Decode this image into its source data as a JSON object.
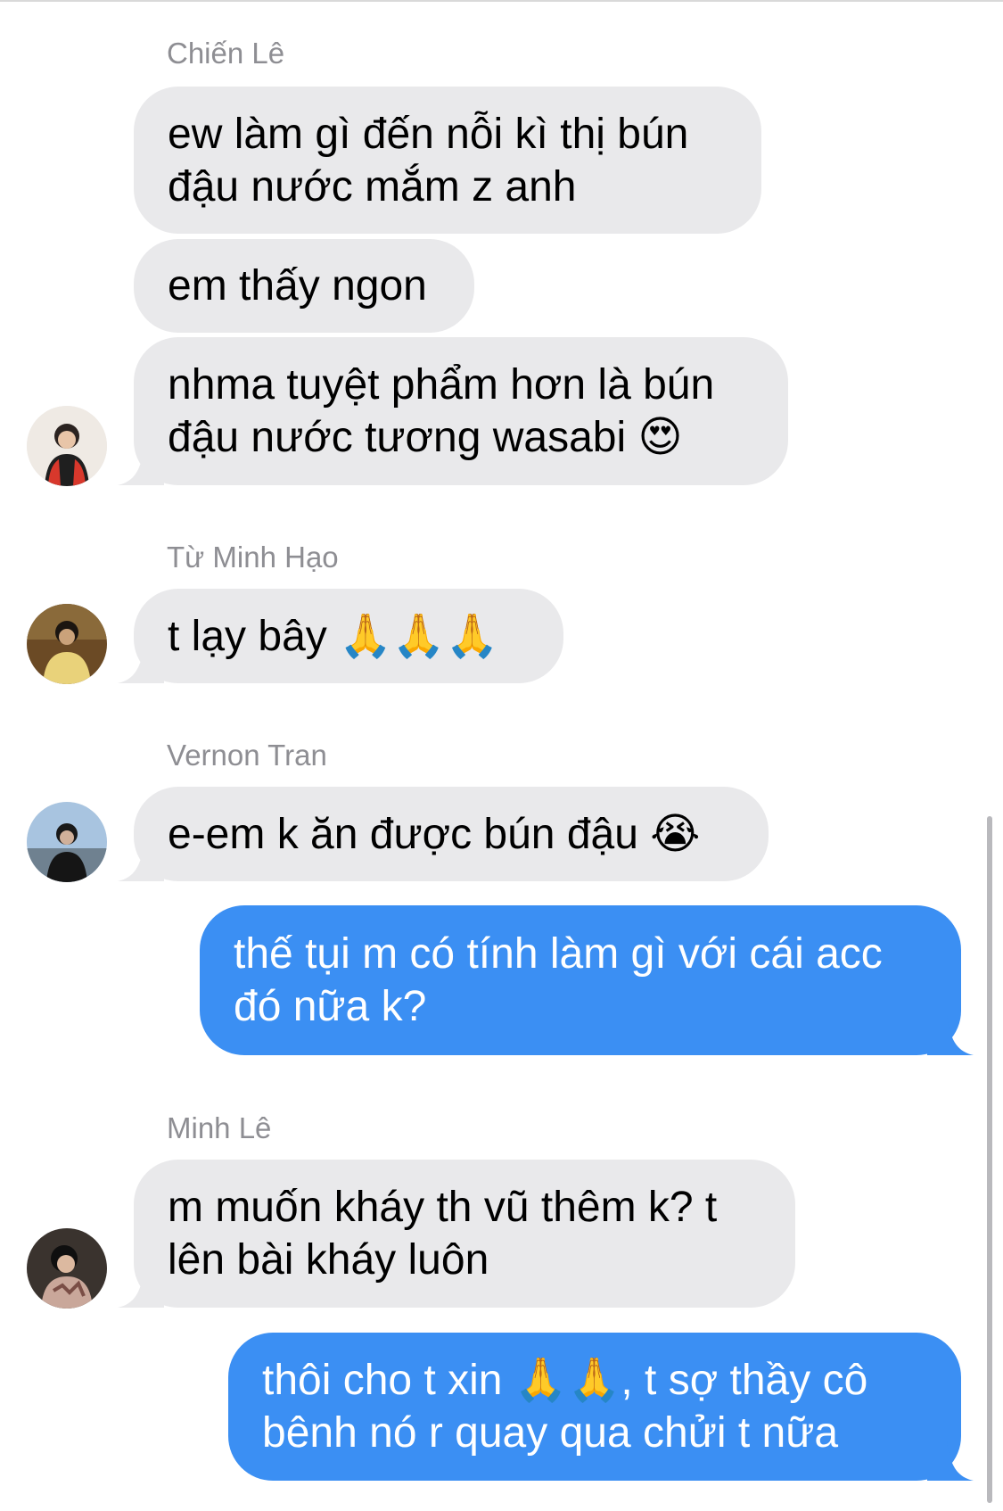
{
  "colors": {
    "incoming_bubble": "#e9e9eb",
    "outgoing_bubble": "#3b8ff3",
    "sender_name": "#8e8e93"
  },
  "groups": [
    {
      "sender": "Chiến Lê",
      "messages": [
        "ew làm gì đến nỗi kì thị bún\nđậu nước mắm z anh",
        "em thấy ngon",
        "nhma tuyệt phẩm hơn là bún\nđậu nước tương wasabi 😍"
      ]
    },
    {
      "sender": "Từ Minh Hạo",
      "messages": [
        "t lạy bây 🙏🙏🙏"
      ]
    },
    {
      "sender": "Vernon Tran",
      "messages": [
        "e-em k ăn được bún đậu 😭"
      ]
    },
    {
      "sender": "Minh Lê",
      "messages": [
        "m muốn kháy th vũ thêm k? t\nlên bài kháy luôn"
      ]
    }
  ],
  "outgoing": [
    "thế tụi m có tính làm gì với cái acc\nđó nữa k?",
    "thôi cho t xin 🙏🙏, t sợ thầy cô\nbênh nó r quay qua chửi t nữa"
  ],
  "avatars": [
    "avatar-chien-le",
    "avatar-tu-minh-hao",
    "avatar-vernon-tran",
    "avatar-minh-le"
  ]
}
